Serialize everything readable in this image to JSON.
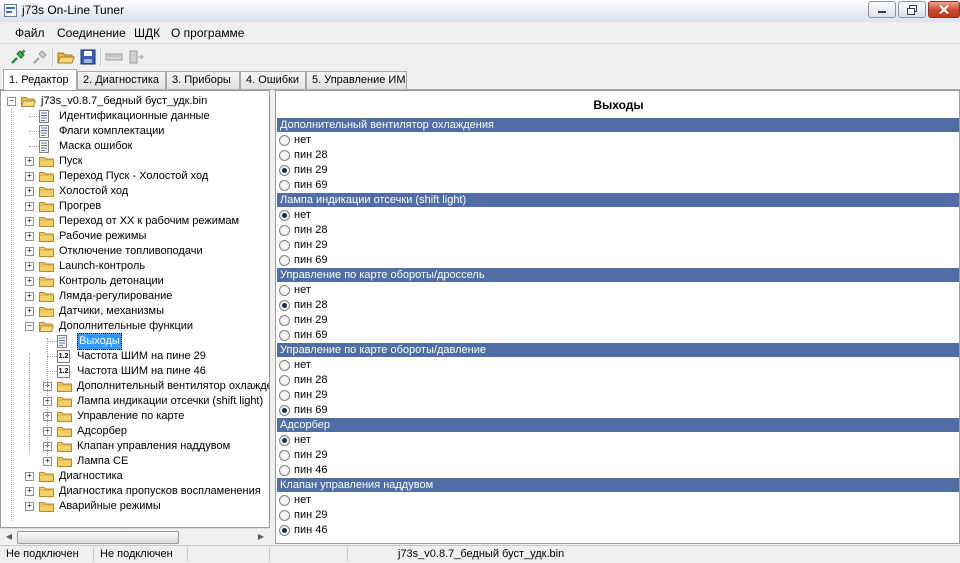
{
  "window": {
    "title": "j73s On-Line Tuner",
    "min_icon": "minimize-icon",
    "max_icon": "maximize-icon",
    "close_icon": "close-icon"
  },
  "menu": [
    "Файл",
    "Соединение",
    "ШДК",
    "О программе"
  ],
  "toolbar": [
    "connect-icon",
    "disconnect-icon",
    "open-folder-icon",
    "save-icon",
    "read-icon",
    "write-icon"
  ],
  "tabs": [
    {
      "label": "1. Редактор",
      "active": true
    },
    {
      "label": "2. Диагностика",
      "active": false
    },
    {
      "label": "3. Приборы",
      "active": false
    },
    {
      "label": "4. Ошибки",
      "active": false
    },
    {
      "label": "5. Управление ИМ",
      "active": false
    }
  ],
  "tree": [
    {
      "label": "j73s_v0.8.7_бедный буст_удк.bin",
      "level": 0,
      "icon": "folder-open",
      "expander": "-"
    },
    {
      "label": "Идентификационные данные",
      "level": 1,
      "icon": "doc"
    },
    {
      "label": "Флаги комплектации",
      "level": 1,
      "icon": "doc"
    },
    {
      "label": "Маска ошибок",
      "level": 1,
      "icon": "doc"
    },
    {
      "label": "Пуск",
      "level": 1,
      "icon": "folder",
      "expander": "+"
    },
    {
      "label": "Переход Пуск - Холостой ход",
      "level": 1,
      "icon": "folder",
      "expander": "+"
    },
    {
      "label": "Холостой ход",
      "level": 1,
      "icon": "folder",
      "expander": "+"
    },
    {
      "label": "Прогрев",
      "level": 1,
      "icon": "folder",
      "expander": "+"
    },
    {
      "label": "Переход от ХХ к рабочим режимам",
      "level": 1,
      "icon": "folder",
      "expander": "+"
    },
    {
      "label": "Рабочие режимы",
      "level": 1,
      "icon": "folder",
      "expander": "+"
    },
    {
      "label": "Отключение топливоподачи",
      "level": 1,
      "icon": "folder",
      "expander": "+"
    },
    {
      "label": "Launch-контроль",
      "level": 1,
      "icon": "folder",
      "expander": "+"
    },
    {
      "label": "Контроль детонации",
      "level": 1,
      "icon": "folder",
      "expander": "+"
    },
    {
      "label": "Лямда-регулирование",
      "level": 1,
      "icon": "folder",
      "expander": "+"
    },
    {
      "label": "Датчики, механизмы",
      "level": 1,
      "icon": "folder",
      "expander": "+"
    },
    {
      "label": "Дополнительные функции",
      "level": 1,
      "icon": "folder-open",
      "expander": "-"
    },
    {
      "label": "Выходы",
      "level": 2,
      "icon": "doc",
      "selected": true
    },
    {
      "label": "Частота ШИМ на пине 29",
      "level": 2,
      "icon": "num"
    },
    {
      "label": "Частота ШИМ на пине 46",
      "level": 2,
      "icon": "num"
    },
    {
      "label": "Дополнительный вентилятор охлаждения",
      "level": 2,
      "icon": "folder",
      "expander": "+"
    },
    {
      "label": "Лампа индикации отсечки (shift light)",
      "level": 2,
      "icon": "folder",
      "expander": "+"
    },
    {
      "label": "Управление по карте",
      "level": 2,
      "icon": "folder",
      "expander": "+"
    },
    {
      "label": "Адсорбер",
      "level": 2,
      "icon": "folder",
      "expander": "+"
    },
    {
      "label": "Клапан управления наддувом",
      "level": 2,
      "icon": "folder",
      "expander": "+"
    },
    {
      "label": "Лампа CE",
      "level": 2,
      "icon": "folder",
      "expander": "+"
    },
    {
      "label": "Диагностика",
      "level": 1,
      "icon": "folder",
      "expander": "+"
    },
    {
      "label": "Диагностика пропусков воспламенения",
      "level": 1,
      "icon": "folder",
      "expander": "+"
    },
    {
      "label": "Аварийные режимы",
      "level": 1,
      "icon": "folder",
      "expander": "+"
    }
  ],
  "panel": {
    "title": "Выходы",
    "groups": [
      {
        "header": "Дополнительный вентилятор охлаждения",
        "options": [
          "нет",
          "пин 28",
          "пин 29",
          "пин 69"
        ],
        "selected": 2
      },
      {
        "header": "Лампа индикации отсечки (shift light)",
        "options": [
          "нет",
          "пин 28",
          "пин 29",
          "пин 69"
        ],
        "selected": 0
      },
      {
        "header": "Управление по карте обороты/дроссель",
        "options": [
          "нет",
          "пин 28",
          "пин 29",
          "пин 69"
        ],
        "selected": 1
      },
      {
        "header": "Управление по карте обороты/давление",
        "options": [
          "нет",
          "пин 28",
          "пин 29",
          "пин 69"
        ],
        "selected": 3
      },
      {
        "header": "Адсорбер",
        "options": [
          "нет",
          "пин 29",
          "пин 46"
        ],
        "selected": 0
      },
      {
        "header": "Клапан управления наддувом",
        "options": [
          "нет",
          "пин 29",
          "пин 46"
        ],
        "selected": 2
      }
    ]
  },
  "status": [
    "Не подключен",
    "Не подключен",
    "",
    "",
    "j73s_v0.8.7_бедный буст_удк.bin"
  ]
}
